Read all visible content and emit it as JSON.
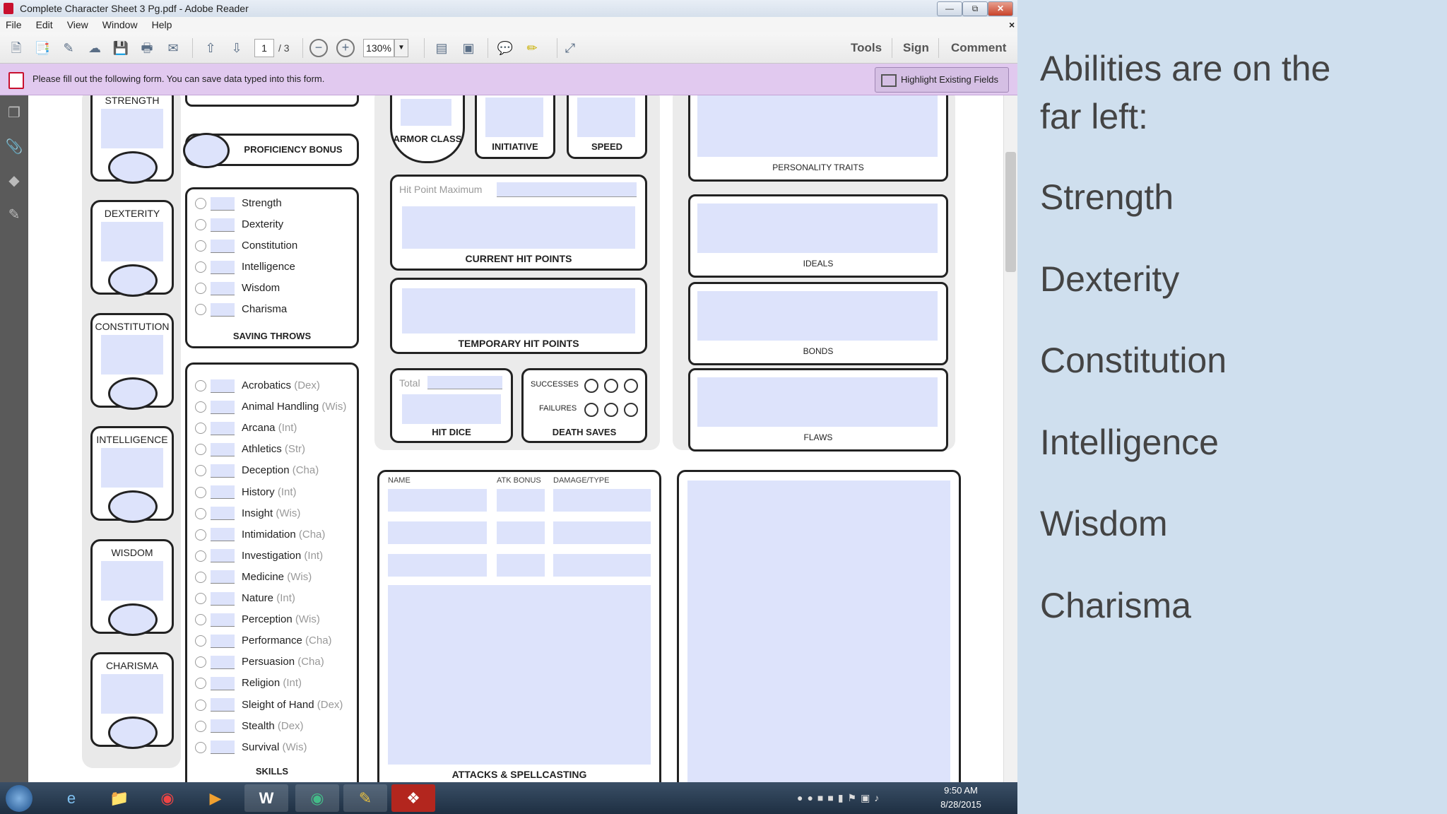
{
  "window": {
    "title": "Complete Character Sheet 3 Pg.pdf - Adobe Reader",
    "close_x": "×"
  },
  "menu": [
    "File",
    "Edit",
    "View",
    "Window",
    "Help"
  ],
  "toolbar": {
    "page": "1",
    "page_total": "/ 3",
    "zoom": "130%",
    "tools": "Tools",
    "sign": "Sign",
    "comment": "Comment"
  },
  "formbar": {
    "message": "Please fill out the following form. You can save data typed into this form.",
    "highlight": "Highlight Existing Fields"
  },
  "abilities": [
    "STRENGTH",
    "DEXTERITY",
    "CONSTITUTION",
    "INTELLIGENCE",
    "WISDOM",
    "CHARISMA"
  ],
  "proficiency": "PROFICIENCY BONUS",
  "saving_throws": {
    "items": [
      "Strength",
      "Dexterity",
      "Constitution",
      "Intelligence",
      "Wisdom",
      "Charisma"
    ],
    "title": "SAVING THROWS"
  },
  "skills": {
    "items": [
      {
        "n": "Acrobatics",
        "a": "(Dex)"
      },
      {
        "n": "Animal Handling",
        "a": "(Wis)"
      },
      {
        "n": "Arcana",
        "a": "(Int)"
      },
      {
        "n": "Athletics",
        "a": "(Str)"
      },
      {
        "n": "Deception",
        "a": "(Cha)"
      },
      {
        "n": "History",
        "a": "(Int)"
      },
      {
        "n": "Insight",
        "a": "(Wis)"
      },
      {
        "n": "Intimidation",
        "a": "(Cha)"
      },
      {
        "n": "Investigation",
        "a": "(Int)"
      },
      {
        "n": "Medicine",
        "a": "(Wis)"
      },
      {
        "n": "Nature",
        "a": "(Int)"
      },
      {
        "n": "Perception",
        "a": "(Wis)"
      },
      {
        "n": "Performance",
        "a": "(Cha)"
      },
      {
        "n": "Persuasion",
        "a": "(Cha)"
      },
      {
        "n": "Religion",
        "a": "(Int)"
      },
      {
        "n": "Sleight of Hand",
        "a": "(Dex)"
      },
      {
        "n": "Stealth",
        "a": "(Dex)"
      },
      {
        "n": "Survival",
        "a": "(Wis)"
      }
    ],
    "title": "SKILLS"
  },
  "combat": {
    "armor_class": "ARMOR CLASS",
    "initiative": "INITIATIVE",
    "speed": "SPEED",
    "hp_max": "Hit Point Maximum",
    "current_hp": "CURRENT HIT POINTS",
    "temp_hp": "TEMPORARY HIT POINTS",
    "total": "Total",
    "hit_dice": "HIT DICE",
    "successes": "SUCCESSES",
    "failures": "FAILURES",
    "death_saves": "DEATH SAVES"
  },
  "attacks": {
    "name": "NAME",
    "atk": "ATK BONUS",
    "dmg": "DAMAGE/TYPE",
    "title": "ATTACKS & SPELLCASTING"
  },
  "traits": [
    "PERSONALITY TRAITS",
    "IDEALS",
    "BONDS",
    "FLAWS"
  ],
  "taskbar": {
    "time": "9:50 AM",
    "date": "8/28/2015"
  },
  "slide": {
    "heading_1": "Abilities are on the",
    "heading_2": "far left:",
    "items": [
      "Strength",
      "Dexterity",
      "Constitution",
      "Intelligence",
      "Wisdom",
      "Charisma"
    ]
  }
}
